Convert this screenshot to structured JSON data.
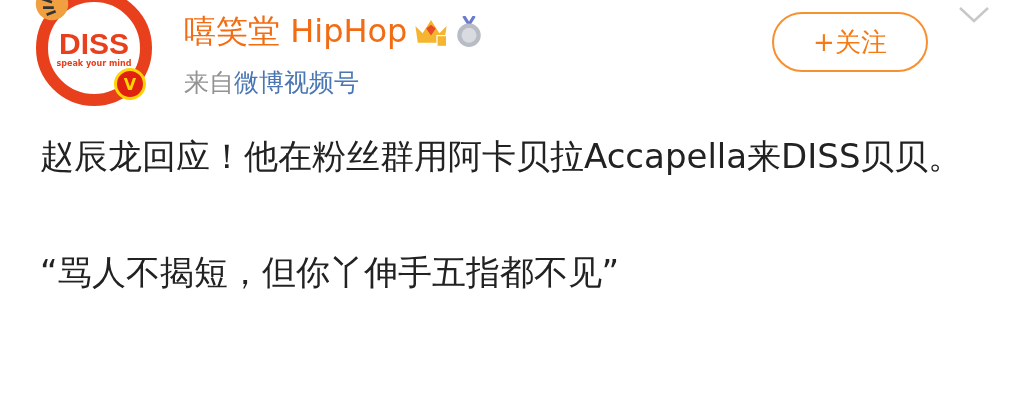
{
  "avatar": {
    "logo_text": "DISS",
    "tagline": "speak your mind",
    "verified_badge": "V"
  },
  "user": {
    "name": "嘻笑堂 HipHop",
    "source_prefix": "来自",
    "source_link": "微博视频号"
  },
  "follow_button": {
    "label": "+关注"
  },
  "post": {
    "paragraphs": [
      "赵辰龙回应！他在粉丝群用阿卡贝拉Accapella来DISS贝贝。",
      "“骂人不揭短，但你丫伸手五指都不见”"
    ]
  }
}
